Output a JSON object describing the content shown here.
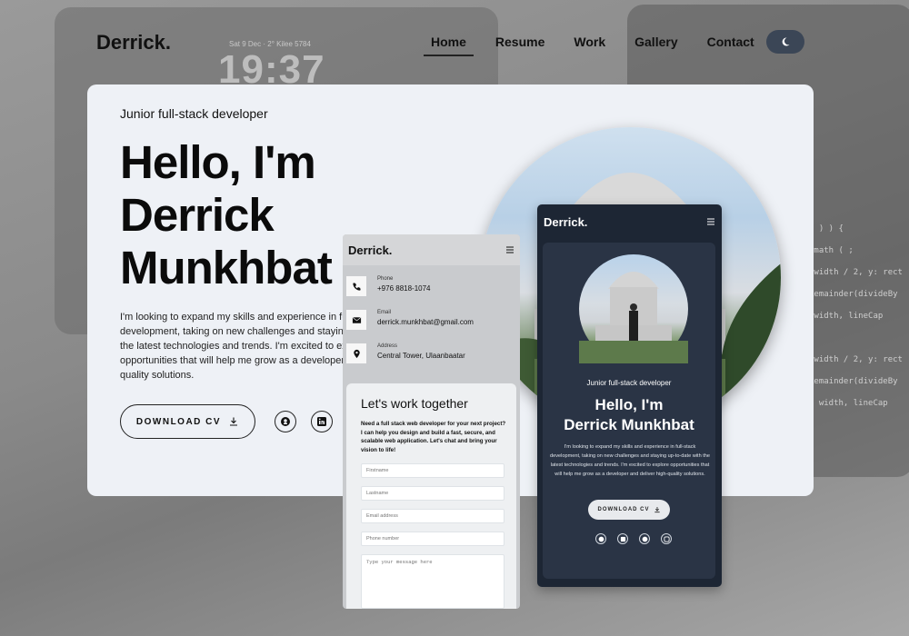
{
  "site": {
    "logo": "Derrick."
  },
  "nav": [
    {
      "label": "Home",
      "active": true
    },
    {
      "label": "Resume",
      "active": false
    },
    {
      "label": "Work",
      "active": false
    },
    {
      "label": "Gallery",
      "active": false
    },
    {
      "label": "Contact",
      "active": false
    }
  ],
  "background": {
    "clock": "19:37",
    "date": "Sat 9 Dec · 2° Kilee 5784"
  },
  "hero": {
    "subtitle": "Junior full-stack developer",
    "headline_lines": [
      "Hello, I'm",
      "Derrick",
      "Munkhbat"
    ],
    "bio_lines": [
      "I'm looking to expand my skills and experience in full-stack",
      "development, taking on new challenges and staying up-to-date with",
      "the latest technologies and trends. I'm excited to explore",
      "opportunities that will help me grow as a developer and deliver high-",
      "quality solutions."
    ],
    "cv_label": "DOWNLOAD CV"
  },
  "mobile_light": {
    "logo": "Derrick.",
    "contacts": [
      {
        "label": "Phone",
        "value": "+976 8818-1074",
        "icon": "phone-icon"
      },
      {
        "label": "Email",
        "value": "derrick.munkhbat@gmail.com",
        "icon": "mail-icon"
      },
      {
        "label": "Address",
        "value": "Central Tower, Ulaanbaatar",
        "icon": "location-icon"
      }
    ],
    "work_title": "Let's work together",
    "work_text": "Need a full stack web developer for your next project? I can help you design and build a fast, secure, and scalable web application. Let's chat and bring your vision to life!",
    "fields": [
      "Firstname",
      "Lastname",
      "Email address",
      "Phone number",
      "Type your message here"
    ]
  },
  "mobile_dark": {
    "logo": "Derrick.",
    "subtitle": "Junior full-stack developer",
    "headline_lines": [
      "Hello, I'm",
      "Derrick Munkhbat"
    ],
    "bio": "I'm looking to expand my skills and experience in full-stack development, taking on new challenges and staying up-to-date with the latest technologies and trends. I'm excited to explore opportunities that will help me grow as a developer and deliver high-quality solutions.",
    "cv_label": "DOWNLOAD CV"
  },
  "colors": {
    "card": "#eef1f6",
    "dark": "#1d2634",
    "toggle": "#3b4656"
  }
}
